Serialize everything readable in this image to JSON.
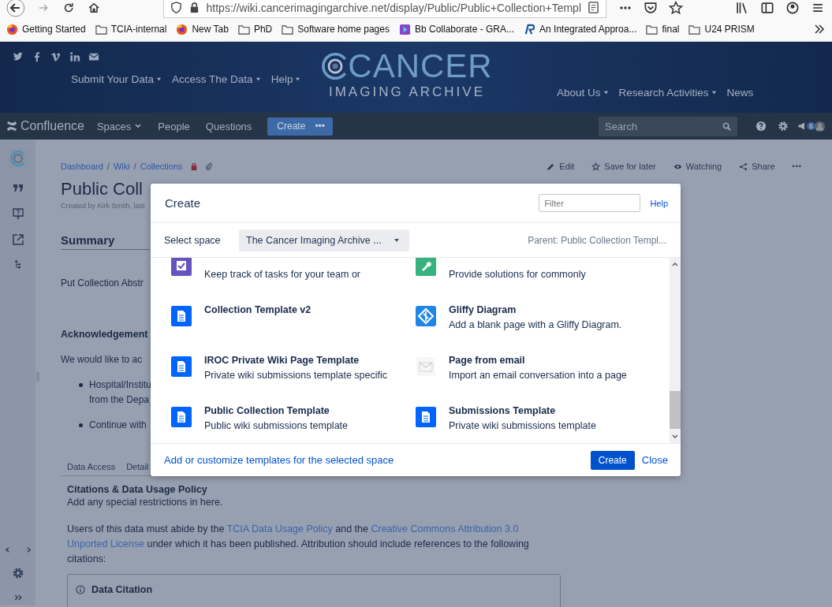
{
  "browser": {
    "url": "https://wiki.cancerimagingarchive.net/display/Public/Public+Collection+Templ",
    "bookmarks": [
      {
        "label": "Getting Started",
        "kind": "firefox"
      },
      {
        "label": "TCIA-internal",
        "kind": "folder"
      },
      {
        "label": "New Tab",
        "kind": "firefox"
      },
      {
        "label": "PhD",
        "kind": "folder"
      },
      {
        "label": "Software home pages",
        "kind": "folder"
      },
      {
        "label": "Bb Collaborate - GRA...",
        "kind": "bb"
      },
      {
        "label": "An Integrated Approa...",
        "kind": "r"
      },
      {
        "label": "final",
        "kind": "folder"
      },
      {
        "label": "U24 PRISM",
        "kind": "folder"
      }
    ]
  },
  "site_header": {
    "nav_left": [
      {
        "label": "Submit Your Data",
        "dropdown": true
      },
      {
        "label": "Access The Data",
        "dropdown": true
      },
      {
        "label": "Help",
        "dropdown": true
      }
    ],
    "logo_top": "CANCER",
    "logo_bottom": "IMAGING ARCHIVE",
    "nav_right": [
      {
        "label": "About Us",
        "dropdown": true
      },
      {
        "label": "Research Activities",
        "dropdown": true
      },
      {
        "label": "News",
        "dropdown": false
      }
    ]
  },
  "confluence_bar": {
    "brand": "Confluence",
    "nav": [
      {
        "label": "Spaces",
        "dropdown": true
      },
      {
        "label": "People",
        "dropdown": false
      },
      {
        "label": "Questions",
        "dropdown": false
      }
    ],
    "create_button": "Create",
    "more_button": "•••",
    "search": {
      "placeholder": "Search"
    },
    "notification_count": "6"
  },
  "page": {
    "breadcrumbs": [
      {
        "text": "Dashboard",
        "kind": "link"
      },
      {
        "text": "/",
        "kind": "separator"
      },
      {
        "text": "Wiki",
        "kind": "link"
      },
      {
        "text": "/",
        "kind": "separator"
      },
      {
        "text": "Collections",
        "kind": "link"
      }
    ],
    "actions": [
      {
        "label": "Edit",
        "kind": "edit"
      },
      {
        "label": "Save for later",
        "kind": "star"
      },
      {
        "label": "Watching",
        "kind": "eye"
      },
      {
        "label": "Share",
        "kind": "share"
      },
      {
        "label": "•••",
        "kind": "more"
      }
    ],
    "title": "Public Coll",
    "byline": "Created by Kirk Smith, last",
    "summary_heading": "Summary",
    "abstract": "Put Collection Abstr",
    "ack_heading": "Acknowledgement",
    "ack_text": "We would like to ac",
    "bullets": [
      {
        "lines": [
          "Hospital/Institu",
          "from the Depa"
        ]
      },
      {
        "lines": [
          "Continue with"
        ]
      }
    ],
    "tabs": [
      "Data Access",
      "Detail"
    ],
    "citations_heading": "Citations & Data Usage Policy",
    "restrictions": "Add any special restrictions in here.",
    "usage_paragraph": [
      {
        "text": "Users of this data must abide by the",
        "kind": "text"
      },
      {
        "text": "TCIA Data Usage Policy",
        "kind": "link"
      },
      {
        "text": "and the",
        "kind": "text"
      },
      {
        "text": "Creative Commons Attribution 3.0",
        "kind": "link"
      },
      {
        "text": "Unported License",
        "kind": "link"
      },
      {
        "text": "under which it has been published. Attribution should include references to the following citations:",
        "kind": "text"
      }
    ],
    "data_citation": {
      "title": "Data Citation"
    }
  },
  "dialog": {
    "title": "Create",
    "filter": {
      "placeholder": "Filter"
    },
    "help": "Help",
    "space_label": "Select space",
    "space_value": "The Cancer Imaging Archive ...",
    "parent": "Parent: Public Collection Templ...",
    "templates": [
      {
        "desc": "Keep track of tasks for your team or",
        "kind": "task"
      },
      {
        "desc": "Provide solutions for commonly",
        "kind": "troubleshoot"
      },
      {
        "title": "Collection Template v2",
        "kind": "page"
      },
      {
        "title": "Gliffy Diagram",
        "desc": "Add a blank page with a Gliffy Diagram.",
        "kind": "gliffy"
      },
      {
        "title": "IROC Private Wiki Page Template",
        "desc": "Private wiki submissions template specific",
        "kind": "page"
      },
      {
        "title": "Page from email",
        "desc": "Import an email conversation into a page",
        "kind": "email"
      },
      {
        "title": "Public Collection Template",
        "desc": "Public wiki submissions template",
        "kind": "page"
      },
      {
        "title": "Submissions Template",
        "desc": "Private wiki submissions template",
        "kind": "page"
      }
    ],
    "footer_link": "Add or customize templates for the selected space",
    "create_button": "Create",
    "close": "Close"
  }
}
